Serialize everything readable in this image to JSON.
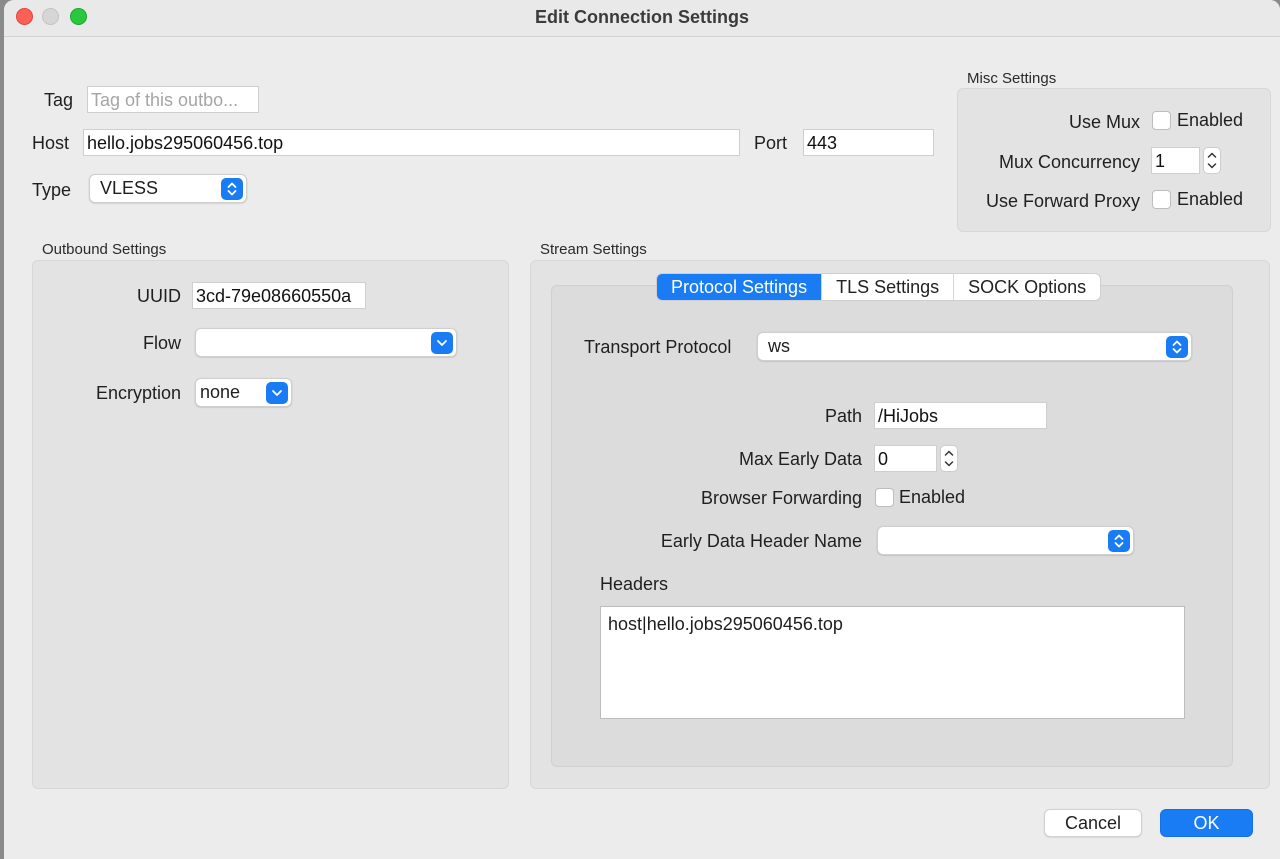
{
  "window": {
    "title": "Edit Connection Settings"
  },
  "general": {
    "tag_label": "Tag",
    "tag_placeholder": "Tag of this outbo...",
    "host_label": "Host",
    "host_value": "hello.jobs295060456.top",
    "port_label": "Port",
    "port_value": "443",
    "type_label": "Type",
    "type_value": "VLESS"
  },
  "misc": {
    "title": "Misc Settings",
    "use_mux_label": "Use Mux",
    "use_mux_checkbox": "Enabled",
    "mux_concurrency_label": "Mux Concurrency",
    "mux_concurrency_value": "1",
    "forward_proxy_label": "Use Forward Proxy",
    "forward_proxy_checkbox": "Enabled"
  },
  "outbound": {
    "title": "Outbound Settings",
    "uuid_label": "UUID",
    "uuid_value": "3cd-79e08660550a",
    "flow_label": "Flow",
    "flow_value": "",
    "encryption_label": "Encryption",
    "encryption_value": "none"
  },
  "stream": {
    "title": "Stream Settings",
    "tabs": [
      {
        "label": "Protocol Settings",
        "active": true
      },
      {
        "label": "TLS Settings",
        "active": false
      },
      {
        "label": "SOCK Options",
        "active": false
      }
    ],
    "transport_label": "Transport Protocol",
    "transport_value": "ws",
    "path_label": "Path",
    "path_value": "/HiJobs",
    "max_early_label": "Max Early Data",
    "max_early_value": "0",
    "browser_fwd_label": "Browser Forwarding",
    "browser_fwd_checkbox": "Enabled",
    "early_header_label": "Early Data Header Name",
    "early_header_value": "",
    "headers_label": "Headers",
    "headers_value": "host|hello.jobs295060456.top"
  },
  "buttons": {
    "cancel": "Cancel",
    "ok": "OK"
  },
  "colors": {
    "accent": "#1a7cf5",
    "close": "#fe5f57",
    "maximize": "#29c840"
  }
}
